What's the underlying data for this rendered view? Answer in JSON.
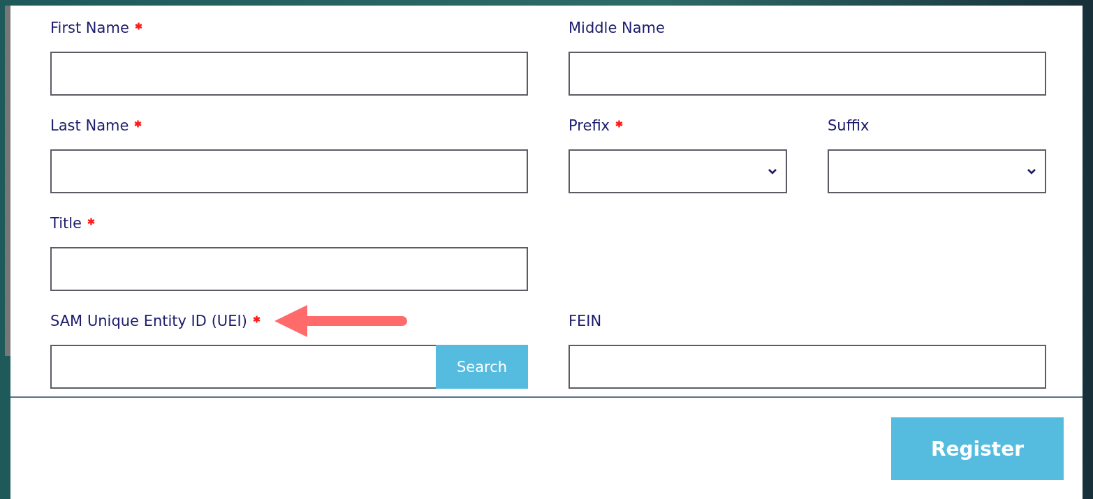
{
  "form": {
    "rows": [
      {
        "fields": [
          {
            "kind": "text",
            "label": "First Name",
            "required": true
          },
          {
            "kind": "text",
            "label": "Middle Name",
            "required": false
          }
        ]
      },
      {
        "fields": [
          {
            "kind": "text",
            "label": "Last Name",
            "required": true
          },
          {
            "kind": "select",
            "label": "Prefix",
            "required": true
          },
          {
            "kind": "select",
            "label": "Suffix",
            "required": false
          }
        ]
      },
      {
        "fields": [
          {
            "kind": "text",
            "label": "Title",
            "required": true
          }
        ]
      },
      {
        "fields": [
          {
            "kind": "search",
            "label": "SAM Unique Entity ID (UEI)",
            "required": true,
            "button": "Search",
            "annotated": true
          },
          {
            "kind": "text",
            "label": "FEIN",
            "required": false
          }
        ]
      }
    ]
  },
  "footer": {
    "button": "Register"
  }
}
